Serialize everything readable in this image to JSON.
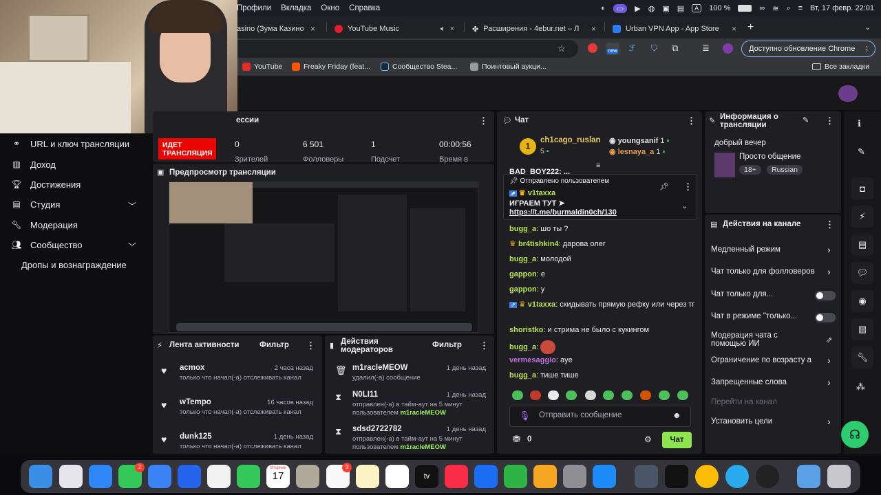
{
  "menubar": {
    "items": [
      "Профили",
      "Вкладка",
      "Окно",
      "Справка"
    ],
    "battery": "100 %",
    "clock": "Вт, 17 февр.  22:01",
    "input_lang": "A"
  },
  "tabs": [
    {
      "label": "asino (Зума Казино",
      "close": "×"
    },
    {
      "label": "YouTube Music",
      "close": "×"
    },
    {
      "label": "Расширения - 4ebur.net – Л",
      "close": "×"
    },
    {
      "label": "Urban VPN App - App Store",
      "close": "×"
    }
  ],
  "new_tab": "+",
  "toolbar": {
    "update_label": "Доступно обновление Chrome",
    "new_badge": "new"
  },
  "bookmarks": [
    "YouTube",
    "Freaky Friday (feat...",
    "Сообщество Stea...",
    "Поинтовый аукци..."
  ],
  "all_bookmarks": "Все закладки",
  "nav": {
    "items": [
      {
        "label": "URL и ключ трансляции"
      },
      {
        "label": "Доход"
      },
      {
        "label": "Достижения"
      },
      {
        "label": "Студия"
      },
      {
        "label": "Модерация"
      },
      {
        "label": "Сообщество"
      },
      {
        "label": "Дропы и вознаграждение"
      }
    ]
  },
  "session": {
    "title": "ессии",
    "live_badge": "ИДЕТ ТРАНСЛЯЦИЯ",
    "stats": [
      {
        "value": "0",
        "label": "Зрителей"
      },
      {
        "value": "6 501",
        "label": "Фолловеры"
      },
      {
        "value": "1",
        "label": "Подсчет"
      },
      {
        "value": "00:00:56",
        "label": "Время в"
      }
    ]
  },
  "preview": {
    "title": "Предпросмотр трансляции"
  },
  "activity": {
    "title": "Лента активности",
    "filter": "Фильтр",
    "items": [
      {
        "name": "acmox",
        "time": "2 часа назад",
        "desc": "только что начал(-а) отслеживать канал"
      },
      {
        "name": "wTempo",
        "time": "16 часов назад",
        "desc": "только что начал(-а) отслеживать канал"
      },
      {
        "name": "dunk125",
        "time": "1 день назад",
        "desc": "только что начал(-а) отслеживать канал"
      }
    ]
  },
  "modactions": {
    "title": "Действия модераторов",
    "filter": "Фильтр",
    "items": [
      {
        "name": "m1racleMEOW",
        "time": "1 день назад",
        "desc": "удалил(-а) сообщение",
        "desc_user": ""
      },
      {
        "name": "N0LI11",
        "time": "1 день назад",
        "desc": "отправлен(-а) в тайм-аут на 5 минут пользователем ",
        "desc_user": "m1racleMEOW"
      },
      {
        "name": "sdsd2722782",
        "time": "1 день назад",
        "desc": "отправлен(-а) в тайм-аут на 5 минут пользователем ",
        "desc_user": "m1racleMEOW"
      }
    ]
  },
  "chat": {
    "title": "Чат",
    "leaders": {
      "first": {
        "name": "ch1cago_ruslan",
        "count": "5",
        "rank": "1"
      },
      "second": {
        "name": "youngsanif",
        "count": "1"
      },
      "third": {
        "name": "lesnaya_a",
        "count": "1"
      }
    },
    "cut_message": "BAD_BOY222: ...",
    "pinned": {
      "header": "Отправлено пользователем",
      "user": "v1taxxa",
      "text": "ИГРАЕМ ТУТ ➤",
      "link": "https://t.me/burmaldin0ch/130"
    },
    "messages": [
      {
        "user": "bugg_a",
        "text": "шо ты ?",
        "color": "#b8e356"
      },
      {
        "user": "br4tishkin4",
        "text": "дарова олег",
        "color": "#b8e356"
      },
      {
        "user": "bugg_a",
        "text": "молодой",
        "color": "#b8e356"
      },
      {
        "user": "gappon",
        "text": "е",
        "color": "#b8e356"
      },
      {
        "user": "gappon",
        "text": "у",
        "color": "#b8e356"
      },
      {
        "user": "v1taxxa",
        "text": "скидывать прямую рефку или через тг",
        "color": "#b8e356"
      },
      {
        "user": "shoristko",
        "text": "и стрима не было с кукингом",
        "color": "#b8e356"
      },
      {
        "user": "bugg_a",
        "text": "",
        "color": "#b8e356"
      },
      {
        "user": "vermesaggio",
        "text": "aye",
        "color": "#bf6ee0"
      },
      {
        "user": "bugg_a",
        "text": "тише тише",
        "color": "#b8e356"
      }
    ],
    "input_placeholder": "Отправить сообщение",
    "points": "0",
    "send_button": "Чат"
  },
  "streaminfo": {
    "title": "Информация о трансляции",
    "stream_title": "добрый вечер",
    "category": "Просто общение",
    "tags": [
      "18+",
      "Russian"
    ]
  },
  "channelactions": {
    "title": "Действия на канале",
    "items": [
      {
        "label": "Медленный режим",
        "control": "chevron"
      },
      {
        "label": "Чат только для фолловеров",
        "control": "chevron"
      },
      {
        "label": "Чат только для...",
        "control": "toggle"
      },
      {
        "label": "Чат в режиме \"только...",
        "control": "toggle"
      },
      {
        "label": "Модерация чата с помощью ИИ",
        "control": "external"
      },
      {
        "label": "Ограничение по возрасту а",
        "control": "chevron"
      },
      {
        "label": "Запрещенные слова",
        "control": "chevron"
      },
      {
        "label": "Перейти на канал",
        "control": "none"
      },
      {
        "label": "Установить цели",
        "control": "chevron"
      }
    ]
  },
  "dock": {
    "badges": {
      "messages": "2",
      "reminders": "3"
    },
    "calendar": {
      "month": "Вторник",
      "day": "17"
    },
    "tv_label": "tv"
  },
  "colors": {
    "live": "#eb0400",
    "accent": "#9147ff",
    "green": "#00c853",
    "link": "#eaeaea"
  }
}
